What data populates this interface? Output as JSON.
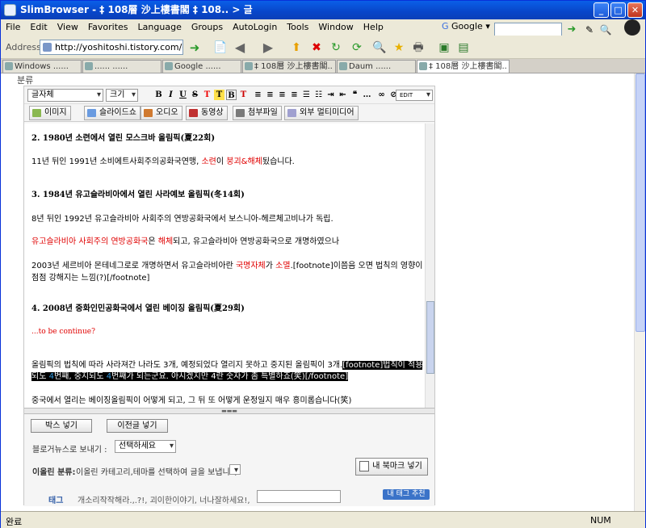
{
  "window": {
    "title": "SlimBrowser - ‡ 108層 沙上樓書閣 ‡ 108.. > 글"
  },
  "menu": [
    "File",
    "Edit",
    "View",
    "Favorites",
    "Language",
    "Groups",
    "AutoLogin",
    "Tools",
    "Window",
    "Help"
  ],
  "address": {
    "label": "Address",
    "url": "http://yoshitoshi.tistory.com/owner"
  },
  "search": {
    "engine": "Google",
    "value": ""
  },
  "tabs": [
    {
      "label": "Windows ......"
    },
    {
      "label": "...... ......"
    },
    {
      "label": "Google ......"
    },
    {
      "label": "‡ 108層 沙上樓書閣.."
    },
    {
      "label": "Daum ......"
    },
    {
      "label": "‡ 108層 沙上樓書閣.."
    }
  ],
  "page": {
    "category_label": "분류",
    "editor": {
      "font_select": "글자체",
      "size_select": "크기",
      "edit_btn": "EDIT",
      "media_buttons": [
        "이미지",
        "슬라이드쇼",
        "오디오",
        "동영상",
        "첨부파일",
        "외부 멀티미디어"
      ]
    },
    "content": {
      "h2": "2. 1980년 소련에서 열린 모스크바 올림픽(夏22회)",
      "p2_a": "11년 뒤인 1991년 소비에트사회주의공화국연맹, ",
      "p2_b": "소련",
      "p2_c": "이 ",
      "p2_d": "붕괴&해체",
      "p2_e": "됬습니다.",
      "h3": "3. 1984년 유고슬라비아에서 열린 사라예보 올림픽(冬14회)",
      "p3": "8년 뒤인 1992년 유고슬라비아 사회주의 연방공화국에서 보스니아-헤르체고비나가 독립.",
      "p4_a": "유고슬라비아 사회주의 연방공화국",
      "p4_b": "은 ",
      "p4_c": "해체",
      "p4_d": "되고, 유고슬라비아 연방공화국으로 개명하였으나",
      "p5_a": "2003년 세르비아 몬테네그로로 개명하면서 유고슬라비아란 ",
      "p5_b": "국명자체",
      "p5_c": "가 ",
      "p5_d": "소멸",
      "p5_e": ".[footnote]이쯤음 오면 법칙의 영향이",
      "p5_f": "점점 강해지는 느낌(?)[/footnote]",
      "h4": "4. 2008년 중화인민공화국에서 열린 베이징 올림픽(夏29회)",
      "cont": "...to be continue?",
      "p6_a": "올림픽의 법칙에 따라 사라져간 나라도 3개, 예정되었다 열리지 못하고 중지된 올림픽이 3개.",
      "p6_b": "[footnote]",
      "p6_c": "법칙이 적용",
      "p6_d": "되도 ",
      "p6_e": "4",
      "p6_f": "번째, 중지되도 ",
      "p6_g": "4",
      "p6_h": "번째가 되는군요. 아시겠지만 4란 숫자가 좀 특별하죠(笑)",
      "p6_i": "[/footnote]",
      "p7": "중국에서 열리는 베이징올림픽이 어떻게 되고, 그 뒤 또 어떻게 운정일지 매우 흥미롭습니다(笑)"
    },
    "lower": {
      "box_btn": "박스 넣기",
      "prev_btn": "이전글 넣기",
      "bloggernews_label": "블로거뉴스로 보내기 :",
      "bloggernews_select": "선택하세요",
      "eolin_label": "이올린 분류:",
      "eolin_text": "이올린 카테고리,테마를 선택하여 글을 보냅니다",
      "bookmark_btn": "내 북마크 넣기",
      "tag_label": "태그",
      "tag_text": "개소리작작해라.,.?!, 괴이한이야기, 너나잘하세요!,",
      "tag_rec": "내 태그 추천"
    }
  },
  "status": {
    "left": "완료",
    "num": "NUM"
  }
}
